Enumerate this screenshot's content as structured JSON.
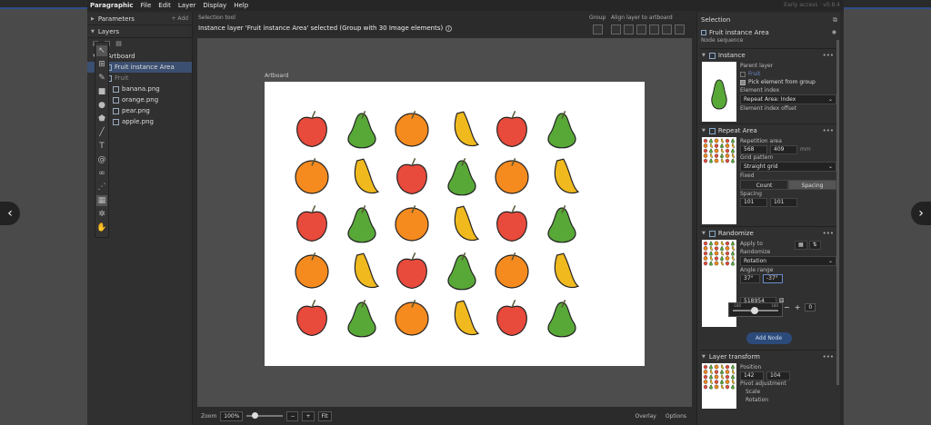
{
  "menubar": {
    "brand": "Paragraphic",
    "items": [
      "File",
      "Edit",
      "Layer",
      "Display",
      "Help"
    ],
    "early": "Early access · v0.8.4"
  },
  "left": {
    "parameters": "Parameters",
    "add": "+ Add",
    "layers": "Layers",
    "tree": [
      {
        "label": "Artboard",
        "depth": 0
      },
      {
        "label": "Fruit instance Area",
        "depth": 1,
        "selected": true
      },
      {
        "label": "Fruit",
        "depth": 1,
        "dim": true
      },
      {
        "label": "banana.png",
        "depth": 2
      },
      {
        "label": "orange.png",
        "depth": 2
      },
      {
        "label": "pear.png",
        "depth": 2
      },
      {
        "label": "apple.png",
        "depth": 2
      }
    ]
  },
  "center": {
    "selection_tool": "Selection tool",
    "status": "Instance layer 'Fruit instance Area' selected (Group with 30 Image elements)",
    "group": "Group",
    "align": "Align layer to artboard",
    "artboard": "Artboard",
    "fruit_grid": [
      [
        "apple",
        "pear",
        "orange",
        "banana",
        "apple",
        "pear"
      ],
      [
        "orange",
        "banana",
        "apple",
        "pear",
        "orange",
        "banana"
      ],
      [
        "apple",
        "pear",
        "orange",
        "banana",
        "apple",
        "pear"
      ],
      [
        "orange",
        "banana",
        "apple",
        "pear",
        "orange",
        "banana"
      ],
      [
        "apple",
        "pear",
        "orange",
        "banana",
        "apple",
        "pear"
      ]
    ],
    "colors": {
      "apple": "#e84a3c",
      "pear": "#58a838",
      "orange": "#f58a1e",
      "banana": "#f0b91e"
    }
  },
  "zoom": {
    "label": "Zoom",
    "value": "100%",
    "fit": "Fit",
    "overlay": "Overlay",
    "options": "Options"
  },
  "right": {
    "selection": "Selection",
    "layer": "Fruit instance Area",
    "node_sequence": "Node sequence",
    "instance": {
      "title": "Instance",
      "parent_layer": "Parent layer",
      "parent_value": "Fruit",
      "pick": "Pick element from group",
      "element_index": "Element index",
      "element_index_value": "Repeat Area: Index",
      "offset": "Element index offset"
    },
    "repeat": {
      "title": "Repeat Area",
      "repetition_area": "Repetition area",
      "w": "568",
      "h": "409",
      "unit": "mm",
      "grid_pattern": "Grid pattern",
      "grid_value": "Straight grid",
      "fixed": "Fixed",
      "count": "Count",
      "spacing": "Spacing",
      "spacing_label": "Spacing",
      "sx": "101",
      "sy": "101"
    },
    "randomize": {
      "title": "Randomize",
      "apply_to": "Apply to",
      "randomize": "Randomize",
      "rand_value": "Rotation",
      "angle_range": "Angle range",
      "a1": "37°",
      "a2": "-37°",
      "seed": "518954",
      "slider_lo": "-180",
      "slider_hi": "180",
      "stepper_value": "0"
    },
    "add_node": "Add Node",
    "transform": {
      "title": "Layer transform",
      "position": "Position",
      "x": "142",
      "y": "104",
      "pivot": "Pivot adjustment",
      "scale": "Scale",
      "rotation": "Rotation"
    }
  }
}
